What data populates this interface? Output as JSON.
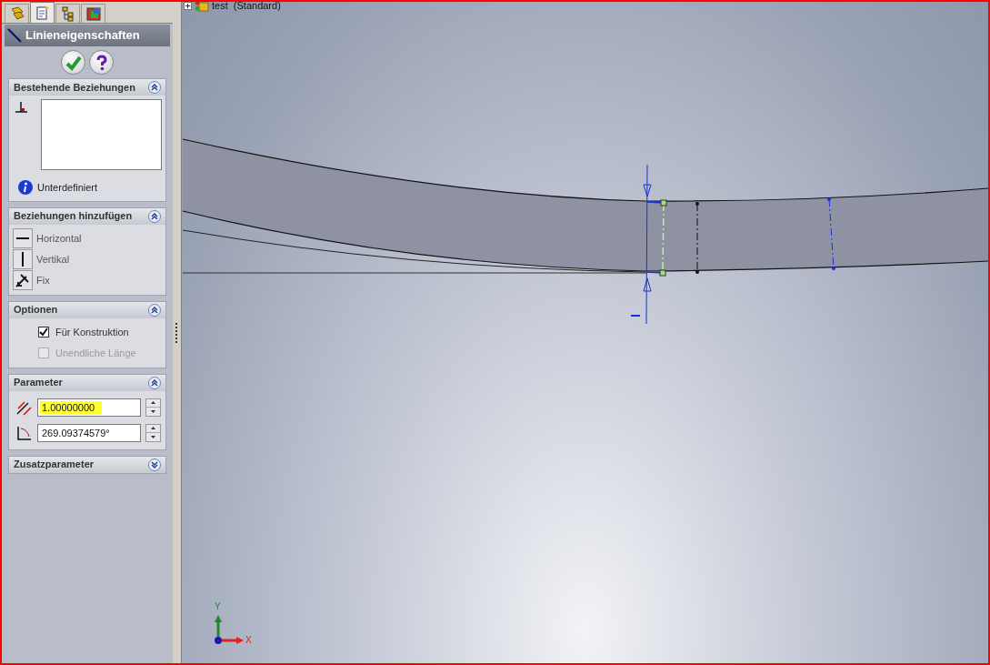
{
  "panel_tabs": [
    {
      "kind": "features",
      "selected": false
    },
    {
      "kind": "properties",
      "selected": true
    },
    {
      "kind": "configurations",
      "selected": false
    },
    {
      "kind": "appearance",
      "selected": false
    }
  ],
  "panel": {
    "title": "Linieneigenschaften"
  },
  "existing_relations": {
    "title": "Bestehende Beziehungen",
    "expanded": true,
    "status": "Unterdefiniert"
  },
  "add_relations": {
    "title": "Beziehungen hinzufügen",
    "expanded": true,
    "items": [
      {
        "kind": "horizontal",
        "label": "Horizontal"
      },
      {
        "kind": "vertical",
        "label": "Vertikal"
      },
      {
        "kind": "fix",
        "label": "Fix"
      }
    ]
  },
  "options": {
    "title": "Optionen",
    "expanded": true,
    "items": [
      {
        "label": "Für Konstruktion",
        "checked": true,
        "disabled": false
      },
      {
        "label": "Unendliche Länge",
        "checked": false,
        "disabled": true
      }
    ]
  },
  "parameters": {
    "title": "Parameter",
    "expanded": true,
    "fields": [
      {
        "kind": "length",
        "value": "1.00000000",
        "highlighted": true
      },
      {
        "kind": "angle",
        "value": "269.09374579°",
        "highlighted": false
      }
    ]
  },
  "extra_parameters": {
    "title": "Zusatzparameter",
    "expanded": false
  },
  "tree": {
    "item": "test  (Standard)"
  },
  "triad": {
    "y_label": "Y",
    "x_label": "X"
  }
}
